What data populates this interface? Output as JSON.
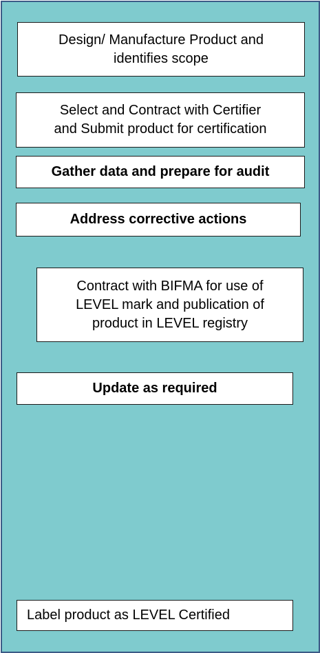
{
  "steps": [
    {
      "lines": [
        "Design/ Manufacture Product and",
        "identifies scope"
      ]
    },
    {
      "lines": [
        "Select and Contract with Certifier",
        "and Submit product for certification"
      ]
    },
    {
      "lines": [
        "Gather data and prepare for audit"
      ]
    },
    {
      "lines": [
        "Address corrective actions"
      ]
    },
    {
      "lines": [
        "Contract with BIFMA for use of",
        "LEVEL mark and publication of",
        "product in LEVEL registry"
      ]
    },
    {
      "lines": [
        "Update as required"
      ]
    },
    {
      "lines": [
        "Label product as LEVEL Certified"
      ]
    }
  ],
  "colors": {
    "panel_background": "#7fcbce",
    "panel_border": "#3b5a86",
    "box_background": "#ffffff",
    "box_border": "#1a1a1a"
  }
}
